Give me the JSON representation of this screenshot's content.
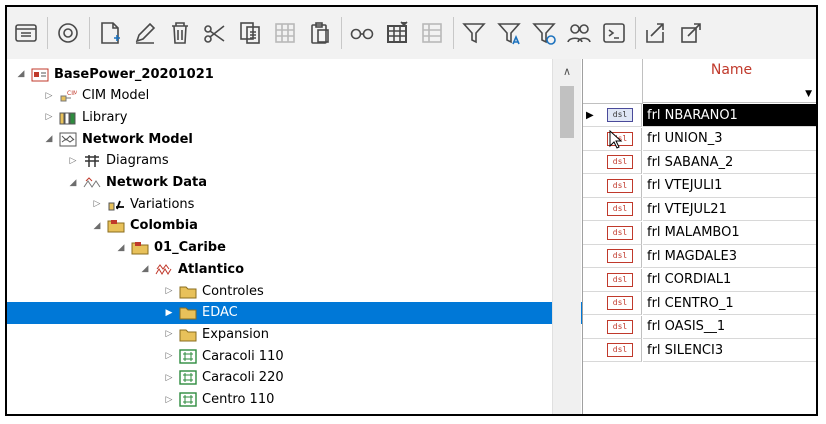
{
  "toolbar": {
    "buttons": [
      "open-folder",
      "refresh",
      "new-object",
      "edit",
      "delete",
      "cut",
      "copy",
      "copy-table",
      "paste",
      "glasses",
      "table-columns",
      "table-disabled",
      "filter",
      "filter-a",
      "filter-clock",
      "users-filter",
      "terminal",
      "export",
      "export-window"
    ]
  },
  "tree": {
    "items": [
      {
        "label": "BasePower_20201021",
        "bold": true,
        "twisty": "◢",
        "icon": "project-icon"
      },
      {
        "label": "CIM Model",
        "bold": false,
        "twisty": "▷",
        "icon": "cim-icon"
      },
      {
        "label": "Library",
        "bold": false,
        "twisty": "▷",
        "icon": "library-icon"
      },
      {
        "label": "Network Model",
        "bold": true,
        "twisty": "◢",
        "icon": "network-model-icon"
      },
      {
        "label": "Diagrams",
        "bold": false,
        "twisty": "▷",
        "icon": "diagrams-icon"
      },
      {
        "label": "Network Data",
        "bold": true,
        "twisty": "◢",
        "icon": "network-data-icon"
      },
      {
        "label": "Variations",
        "bold": false,
        "twisty": "▷",
        "icon": "variations-icon"
      },
      {
        "label": "Colombia",
        "bold": true,
        "twisty": "◢",
        "icon": "grid-folder-icon"
      },
      {
        "label": "01_Caribe",
        "bold": true,
        "twisty": "◢",
        "icon": "grid-folder-icon"
      },
      {
        "label": "Atlantico",
        "bold": true,
        "twisty": "◢",
        "icon": "area-icon"
      },
      {
        "label": "Controles",
        "bold": false,
        "twisty": "▷",
        "icon": "folder-icon"
      },
      {
        "label": "EDAC",
        "bold": false,
        "twisty": "▶",
        "icon": "folder-icon",
        "selected": true
      },
      {
        "label": "Expansion",
        "bold": false,
        "twisty": "▷",
        "icon": "folder-icon"
      },
      {
        "label": "Caracoli 110",
        "bold": false,
        "twisty": "▷",
        "icon": "substation-icon"
      },
      {
        "label": "Caracoli 220",
        "bold": false,
        "twisty": "▷",
        "icon": "substation-icon"
      },
      {
        "label": "Centro 110",
        "bold": false,
        "twisty": "▷",
        "icon": "substation-icon"
      }
    ]
  },
  "grid": {
    "column_header": "Name",
    "badge": "dsl",
    "rows": [
      {
        "name": "frl NBARANO1",
        "selected": true
      },
      {
        "name": "frl UNION_3"
      },
      {
        "name": "frl SABANA_2"
      },
      {
        "name": "frl VTEJULI1"
      },
      {
        "name": "frl VTEJUL21"
      },
      {
        "name": "frl MALAMBO1"
      },
      {
        "name": "frl MAGDALE3"
      },
      {
        "name": "frl CORDIAL1"
      },
      {
        "name": "frl CENTRO_1"
      },
      {
        "name": "frl OASIS__1"
      },
      {
        "name": "frl SILENCI3"
      }
    ]
  },
  "colors": {
    "selection": "#0078d7",
    "badge_red": "#c0392b",
    "folder_yellow": "#e8c15a",
    "substation_green": "#2e8b3e"
  }
}
